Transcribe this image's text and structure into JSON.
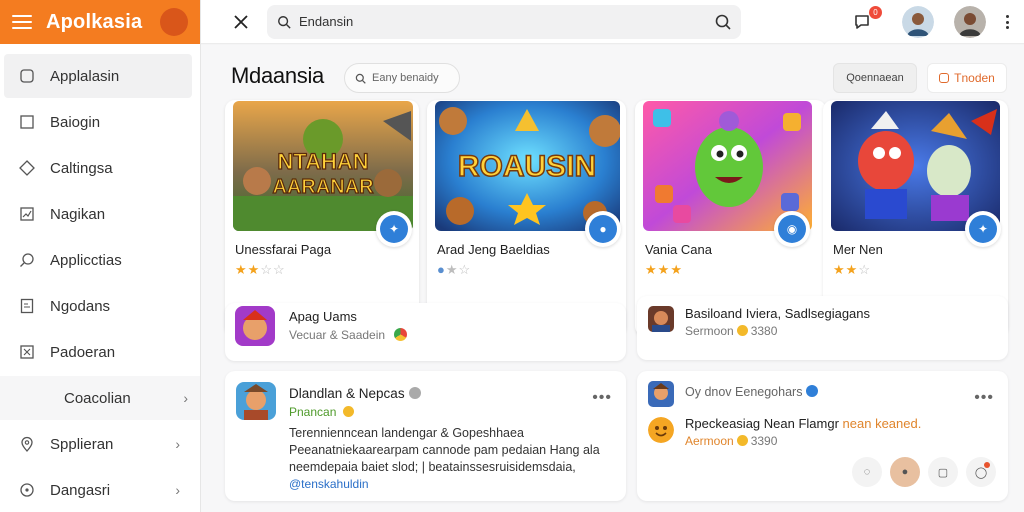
{
  "brand": {
    "title": "Apolkasia"
  },
  "sidebar": {
    "items": [
      {
        "label": "Applalasin",
        "icon": "rounded-square-icon",
        "active": true
      },
      {
        "label": "Baiogin",
        "icon": "square-icon"
      },
      {
        "label": "Caltingsa",
        "icon": "diamond-icon"
      },
      {
        "label": "Nagikan",
        "icon": "chart-icon"
      },
      {
        "label": "Applicctias",
        "icon": "search-icon"
      },
      {
        "label": "Ngodans",
        "icon": "document-icon"
      },
      {
        "label": "Padoeran",
        "icon": "grid-icon"
      },
      {
        "label": "Coacolian",
        "icon": "",
        "chevron": true,
        "highlight": true
      },
      {
        "label": "Spplieran",
        "icon": "pin-icon",
        "chevron": true
      },
      {
        "label": "Dangasri",
        "icon": "circle-icon",
        "chevron": true
      }
    ]
  },
  "topbar": {
    "search_value": "Endansin",
    "notification_count": "0"
  },
  "main": {
    "title": "Mdaansia",
    "chip_search_placeholder": "Eany benaidy",
    "button_a": "Qoennaean",
    "button_b": "Tnoden"
  },
  "games": [
    {
      "name": "Unessfarai Paga",
      "art_text_1": "NTAHAN",
      "art_text_2": "AARANAR",
      "rating": 2
    },
    {
      "name": "Arad Jeng Baeldias",
      "art_text_1": "ROAUSIN",
      "art_text_2": "",
      "rating": 1
    },
    {
      "name": "Vania Cana",
      "art_text_1": "",
      "art_text_2": "",
      "rating": 3
    },
    {
      "name": "Mer Nen",
      "art_text_1": "",
      "art_text_2": "",
      "rating": 2
    }
  ],
  "mini_cards": {
    "left": {
      "title": "Apag Uams",
      "sub": "Vecuar & Saadein"
    },
    "right": {
      "title": "Basiloand Iviera, Sadlsegiagans",
      "sub": "Sermoon",
      "sub_value": "3380"
    }
  },
  "posts": {
    "left": {
      "title": "Dlandlan & Nepcas",
      "tag": "Pnancan",
      "body_1": "Terennienncean landengar & Gopeshhaea",
      "body_2": "Peeanatniekaarearpam cannode pam pedaian Hang ala",
      "body_3": "neemdepaia baiet slod; | beatainssesruisidemsdaia,",
      "hashtag": "@tenskahuldin"
    },
    "right": {
      "author": "Oy dnov Eenegohars",
      "title_prefix": "Rpeckeasiag Nean Flamgr",
      "title_suffix": "nean keaned.",
      "sub": "Aermoon",
      "sub_value": "3390"
    }
  }
}
